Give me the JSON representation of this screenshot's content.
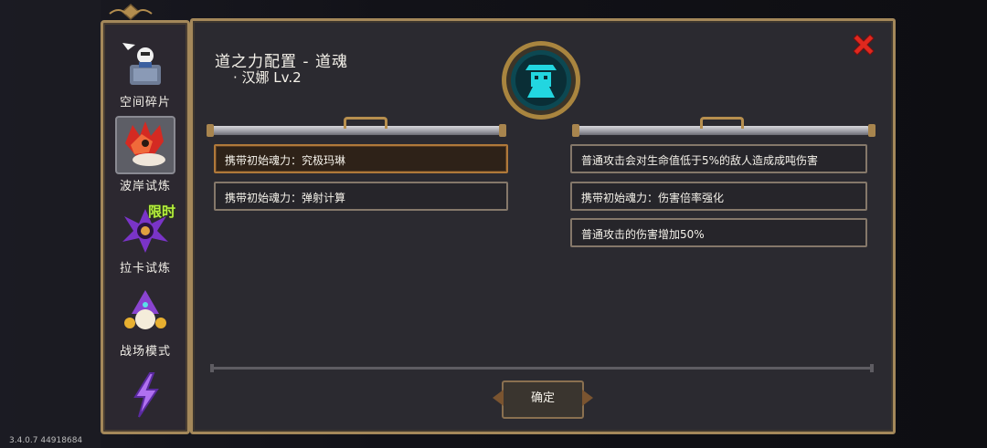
{
  "version": "3.4.0.7 44918684",
  "sidebar": {
    "items": [
      {
        "label": "空间碎片",
        "icon": "shard-cauldron-icon"
      },
      {
        "label": "波岸试炼",
        "icon": "red-feather-beast-icon"
      },
      {
        "label": "拉卡试炼",
        "icon": "purple-flower-icon",
        "tag": "限时"
      },
      {
        "label": "战场模式",
        "icon": "wizard-icon"
      },
      {
        "label": "",
        "icon": "lightning-icon"
      }
    ],
    "active_index": 1
  },
  "panel": {
    "title": "道之力配置 - 道魂",
    "subtitle": "· 汉娜 Lv.2",
    "emblem_icon": "hanna-portrait-icon",
    "close_icon": "close-icon",
    "left_options": [
      {
        "text": "携带初始魂力：究极玛琳",
        "selected": true
      },
      {
        "text": "携带初始魂力：弹射计算",
        "selected": false
      }
    ],
    "right_options": [
      {
        "text": "普通攻击会对生命值低于5%的敌人造成成吨伤害"
      },
      {
        "text": "携带初始魂力：伤害倍率强化"
      },
      {
        "text": "普通攻击的伤害增加50%"
      }
    ],
    "confirm_label": "确定"
  },
  "colors": {
    "frame_gold": "#a4885a",
    "panel_bg": "#2b2a30",
    "close_red": "#e0281e",
    "limited_green": "#b6f03c",
    "emblem_cyan": "#22d6e0"
  }
}
